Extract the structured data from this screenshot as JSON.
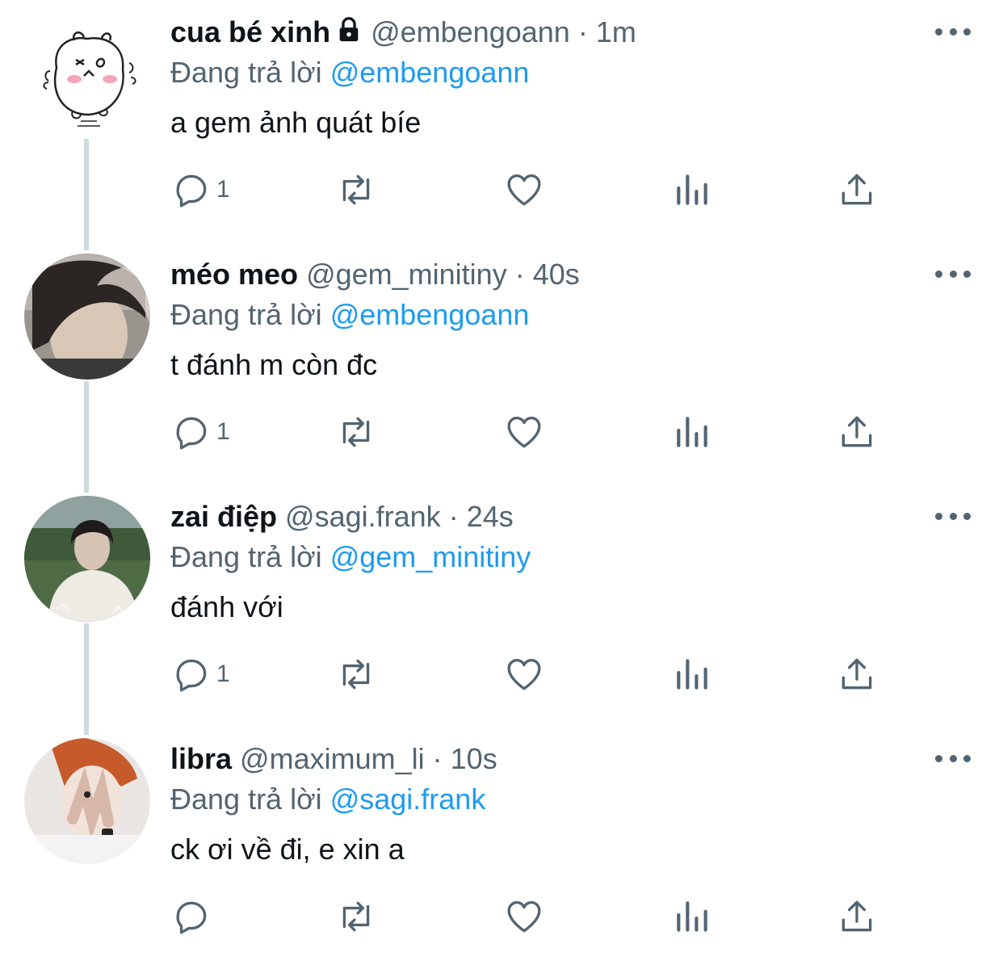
{
  "colors": {
    "text": "#0f1419",
    "secondary": "#536471",
    "link": "#1d9bf0",
    "thread_line": "#cfd9de"
  },
  "icons": {
    "reply": "speech-bubble-icon",
    "retweet": "retweet-arrows-icon",
    "like": "heart-icon",
    "views": "bar-chart-icon",
    "share": "share-upload-icon",
    "more": "three-dots-icon",
    "lock": "lock-icon"
  },
  "tweets": [
    {
      "name": "cua bé xinh",
      "handle": "@embengoann",
      "separator": "·",
      "time": "1m",
      "replying_label": "Đang trả lời",
      "replying_to": "@embengoann",
      "text": "a gem ảnh quát bíe",
      "reply_count": "1",
      "protected": true,
      "avatar": "cartoon-hamster-avatar"
    },
    {
      "name": "méo meo",
      "handle": "@gem_minitiny",
      "separator": "·",
      "time": "40s",
      "replying_label": "Đang trả lời",
      "replying_to": "@embengoann",
      "text": "t đánh m còn đc",
      "reply_count": "1",
      "protected": false,
      "avatar": "photo-avatar-dark-hair"
    },
    {
      "name": "zai điệp",
      "handle": "@sagi.frank",
      "separator": "·",
      "time": "24s",
      "replying_label": "Đang trả lời",
      "replying_to": "@gem_minitiny",
      "text": "đánh với",
      "reply_count": "1",
      "protected": false,
      "avatar": "photo-avatar-garden"
    },
    {
      "name": "libra",
      "handle": "@maximum_li",
      "separator": "·",
      "time": "10s",
      "replying_label": "Đang trả lời",
      "replying_to": "@sagi.frank",
      "text": "ck ơi về đi, e xin a",
      "reply_count": "",
      "protected": false,
      "avatar": "photo-avatar-red-hair"
    }
  ]
}
